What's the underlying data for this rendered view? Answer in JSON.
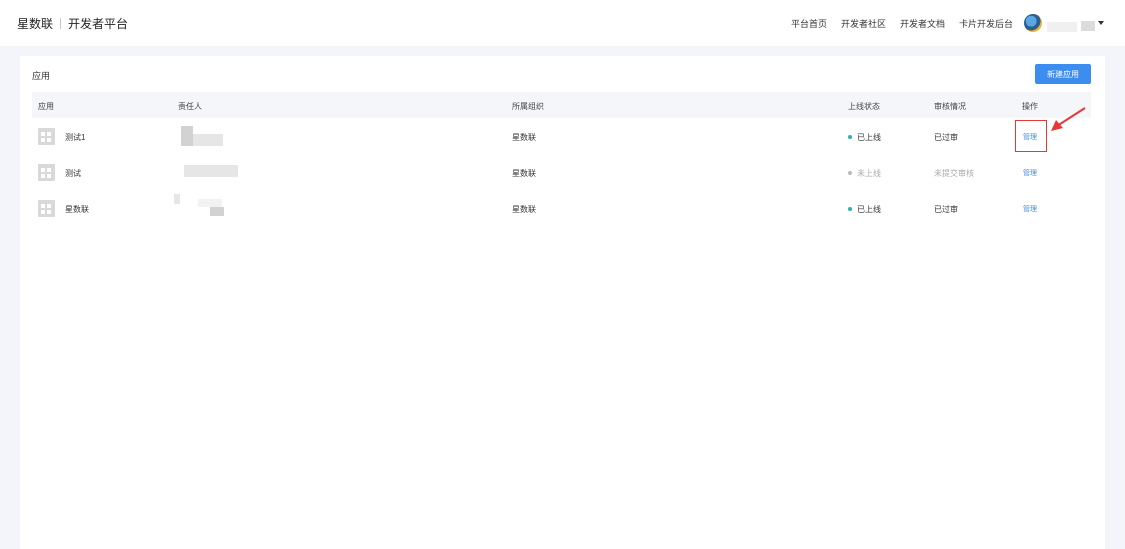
{
  "header": {
    "brand": "星数联",
    "platform": "开发者平台",
    "nav": [
      "平台首页",
      "开发者社区",
      "开发者文档",
      "卡片开发后台"
    ]
  },
  "card": {
    "title": "应用",
    "new_button": "新建应用",
    "columns": {
      "app": "应用",
      "owner": "责任人",
      "org": "所属组织",
      "online_status": "上线状态",
      "review": "审核情况",
      "action": "操作"
    },
    "rows": [
      {
        "name": "测试1",
        "org": "星数联",
        "status": "已上线",
        "review": "已过审",
        "action": "管理"
      },
      {
        "name": "测试",
        "org": "星数联",
        "status": "未上线",
        "review": "未提交审核",
        "action": "管理"
      },
      {
        "name": "星数联",
        "org": "星数联",
        "status": "已上线",
        "review": "已过审",
        "action": "管理"
      }
    ]
  },
  "colors": {
    "primary": "#3d8cf0",
    "online_dot": "#2bb5a8",
    "offline_dot": "#bbbbbb",
    "annotation": "#e53935"
  }
}
